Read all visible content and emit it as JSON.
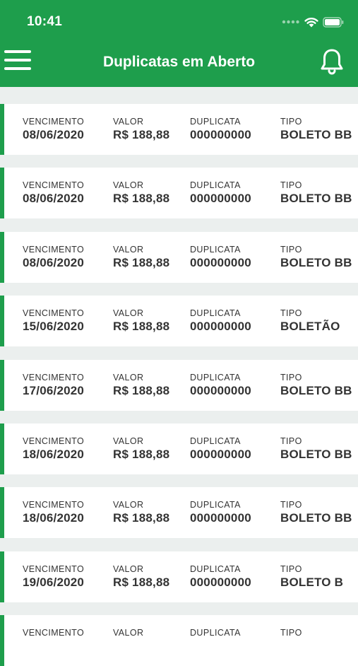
{
  "status_bar": {
    "time": "10:41"
  },
  "header": {
    "title": "Duplicatas em Aberto"
  },
  "labels": {
    "vencimento": "VENCIMENTO",
    "valor": "VALOR",
    "duplicata": "DUPLICATA",
    "tipo": "TIPO"
  },
  "colors": {
    "brand_green": "#1e9e4c",
    "background": "#ebefee",
    "text": "#333333"
  },
  "icons": {
    "menu": "hamburger-menu-icon",
    "notifications": "bell-icon",
    "wifi": "wifi-icon",
    "battery": "battery-icon",
    "signal": "signal-icon"
  },
  "items": [
    {
      "vencimento": "08/06/2020",
      "valor": "R$ 188,88",
      "duplicata": "000000000",
      "tipo": "BOLETO BB"
    },
    {
      "vencimento": "08/06/2020",
      "valor": "R$ 188,88",
      "duplicata": "000000000",
      "tipo": "BOLETO BB"
    },
    {
      "vencimento": "08/06/2020",
      "valor": "R$ 188,88",
      "duplicata": "000000000",
      "tipo": "BOLETO BB"
    },
    {
      "vencimento": "15/06/2020",
      "valor": "R$ 188,88",
      "duplicata": "000000000",
      "tipo": "BOLETÃO"
    },
    {
      "vencimento": "17/06/2020",
      "valor": "R$ 188,88",
      "duplicata": "000000000",
      "tipo": "BOLETO BB"
    },
    {
      "vencimento": "18/06/2020",
      "valor": "R$ 188,88",
      "duplicata": "000000000",
      "tipo": "BOLETO BB"
    },
    {
      "vencimento": "18/06/2020",
      "valor": "R$ 188,88",
      "duplicata": "000000000",
      "tipo": "BOLETO BB"
    },
    {
      "vencimento": "19/06/2020",
      "valor": "R$ 188,88",
      "duplicata": "000000000",
      "tipo": "BOLETO B"
    },
    {
      "vencimento": "",
      "valor": "",
      "duplicata": "",
      "tipo": ""
    }
  ]
}
